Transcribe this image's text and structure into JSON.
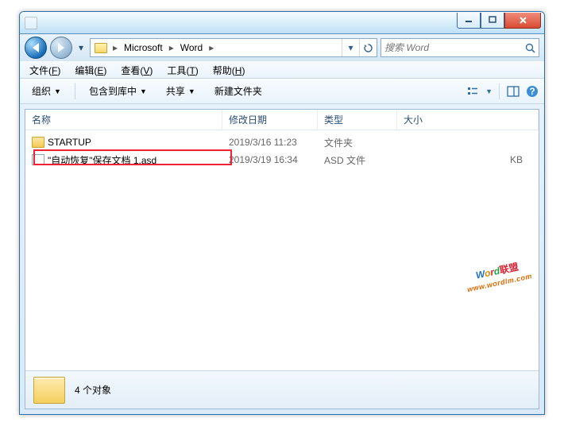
{
  "breadcrumbs": [
    "Microsoft",
    "Word"
  ],
  "search": {
    "placeholder": "搜索 Word"
  },
  "menubar": [
    {
      "label": "文件",
      "key": "F"
    },
    {
      "label": "编辑",
      "key": "E"
    },
    {
      "label": "查看",
      "key": "V"
    },
    {
      "label": "工具",
      "key": "T"
    },
    {
      "label": "帮助",
      "key": "H"
    }
  ],
  "toolbar": {
    "organize": "组织",
    "include": "包含到库中",
    "share": "共享",
    "newfolder": "新建文件夹"
  },
  "columns": {
    "name": "名称",
    "date": "修改日期",
    "type": "类型",
    "size": "大小"
  },
  "files": [
    {
      "icon": "folder",
      "name": "STARTUP",
      "date": "2019/3/16 11:23",
      "type": "文件夹",
      "size": ""
    },
    {
      "icon": "doc",
      "name": "\"自动恢复\"保存文档 1.asd",
      "date": "2019/3/19 16:34",
      "type": "ASD 文件",
      "size": "KB"
    }
  ],
  "status": {
    "count": "4 个对象"
  },
  "watermark": {
    "url": "www.wordlm.com"
  }
}
